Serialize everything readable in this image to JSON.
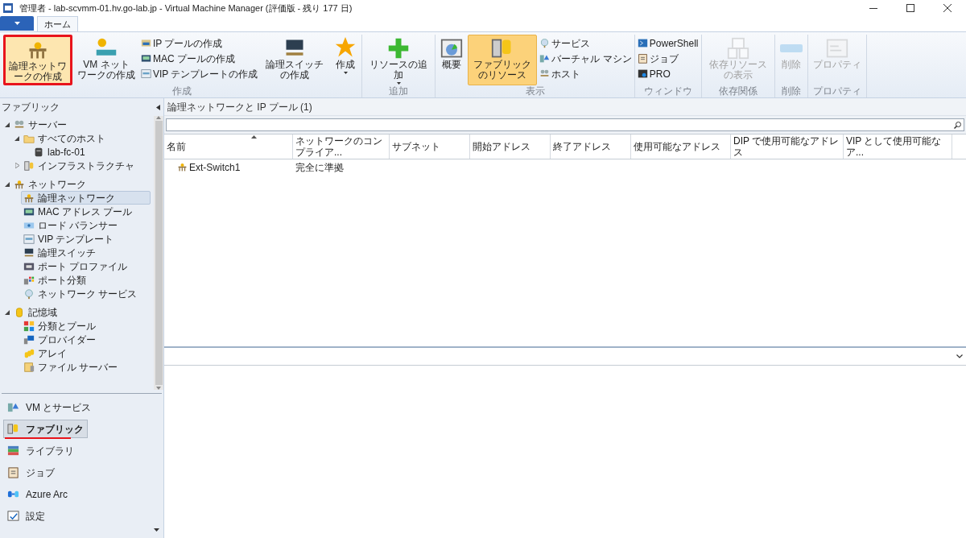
{
  "window": {
    "title": "管理者 - lab-scvmm-01.hv.go-lab.jp - Virtual Machine Manager (評価版 - 残り 177 日)"
  },
  "tabs": [
    {
      "label": "ホーム",
      "selected": true
    }
  ],
  "ribbon": {
    "groups": [
      {
        "label": "作成",
        "items": [
          {
            "kind": "large",
            "lines": [
              "論理ネットワークの作成"
            ],
            "selected": false,
            "highlighted": true,
            "dropdown": false
          },
          {
            "kind": "large",
            "lines": [
              "VM ネット",
              "ワークの作成"
            ],
            "selected": false,
            "highlighted": false,
            "dropdown": false
          },
          {
            "kind": "stack",
            "entries": [
              "IP プールの作成",
              "MAC プールの作成",
              "VIP テンプレートの作成"
            ]
          },
          {
            "kind": "large",
            "lines": [
              "論理スイッチの作成"
            ],
            "selected": false,
            "highlighted": false,
            "dropdown": false
          },
          {
            "kind": "large",
            "lines": [
              "作成"
            ],
            "selected": false,
            "highlighted": false,
            "dropdown": true
          }
        ]
      },
      {
        "label": "追加",
        "items": [
          {
            "kind": "large",
            "lines": [
              "リソースの追加"
            ],
            "selected": false,
            "highlighted": false,
            "dropdown": true
          }
        ]
      },
      {
        "label": "表示",
        "items": [
          {
            "kind": "large",
            "lines": [
              "概要"
            ],
            "selected": false,
            "highlighted": false,
            "dropdown": false
          },
          {
            "kind": "large",
            "lines": [
              "ファブリックのリソース"
            ],
            "selected": true,
            "highlighted": false,
            "dropdown": false
          },
          {
            "kind": "stack",
            "entries": [
              "サービス",
              "バーチャル マシン",
              "ホスト"
            ]
          }
        ]
      },
      {
        "label": "ウィンドウ",
        "items": [
          {
            "kind": "stack",
            "entries": [
              "PowerShell",
              "ジョブ",
              "PRO"
            ]
          }
        ]
      },
      {
        "label": "依存関係",
        "items": [
          {
            "kind": "large",
            "lines": [
              "依存リソースの表示"
            ],
            "selected": false,
            "highlighted": false,
            "dropdown": false,
            "disabled": true
          }
        ]
      },
      {
        "label": "削除",
        "items": [
          {
            "kind": "large",
            "lines": [
              "削除"
            ],
            "selected": false,
            "highlighted": false,
            "dropdown": false,
            "disabled": true
          }
        ]
      },
      {
        "label": "プロパティ",
        "items": [
          {
            "kind": "large",
            "lines": [
              "プロパティ"
            ],
            "selected": false,
            "highlighted": false,
            "dropdown": false,
            "disabled": true
          }
        ]
      }
    ]
  },
  "sidebar": {
    "title": "ファブリック",
    "tree": [
      {
        "label": "サーバー",
        "expanded": true,
        "selected": false,
        "children": [
          {
            "label": "すべてのホスト",
            "expanded": true,
            "selected": false,
            "children": [
              {
                "label": "lab-fc-01",
                "selected": false
              }
            ]
          },
          {
            "label": "インフラストラクチャ",
            "expanded": false,
            "selected": false
          }
        ]
      },
      {
        "label": "ネットワーク",
        "expanded": true,
        "selected": false,
        "children": [
          {
            "label": "論理ネットワーク",
            "selected": true
          },
          {
            "label": "MAC アドレス プール",
            "selected": false
          },
          {
            "label": "ロード バランサー",
            "selected": false
          },
          {
            "label": "VIP テンプレート",
            "selected": false
          },
          {
            "label": "論理スイッチ",
            "selected": false
          },
          {
            "label": "ポート プロファイル",
            "selected": false
          },
          {
            "label": "ポート分類",
            "selected": false
          },
          {
            "label": "ネットワーク サービス",
            "selected": false
          }
        ]
      },
      {
        "label": "記憶域",
        "expanded": true,
        "selected": false,
        "children": [
          {
            "label": "分類とプール",
            "selected": false
          },
          {
            "label": "プロバイダー",
            "selected": false
          },
          {
            "label": "アレイ",
            "selected": false
          },
          {
            "label": "ファイル サーバー",
            "selected": false
          }
        ]
      }
    ],
    "workspaces": [
      {
        "label": "VM とサービス",
        "selected": false,
        "underlined": false
      },
      {
        "label": "ファブリック",
        "selected": true,
        "underlined": true
      },
      {
        "label": "ライブラリ",
        "selected": false,
        "underlined": false
      },
      {
        "label": "ジョブ",
        "selected": false,
        "underlined": false
      },
      {
        "label": "Azure Arc",
        "selected": false,
        "underlined": false
      },
      {
        "label": "設定",
        "selected": false,
        "underlined": false
      }
    ]
  },
  "content": {
    "title": "論理ネットワークと IP プール (1)",
    "table": {
      "columns": [
        "名前",
        "ネットワークのコンプライア...",
        "サブネット",
        "開始アドレス",
        "終了アドレス",
        "使用可能なアドレス",
        "DIP で使用可能なアドレス",
        "VIP として使用可能なア..."
      ],
      "rows": [
        [
          "Ext-Switch1",
          "完全に準拠",
          "",
          "",
          "",
          "",
          "",
          ""
        ]
      ]
    }
  }
}
